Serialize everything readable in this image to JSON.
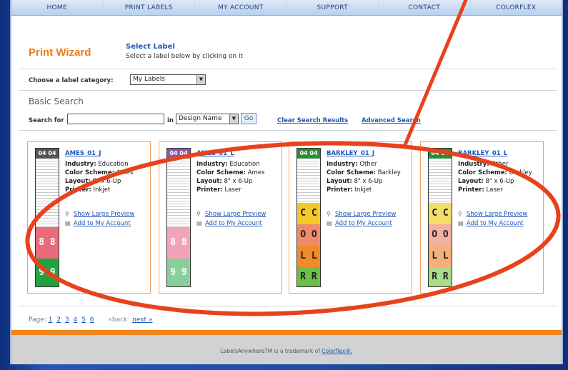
{
  "nav": {
    "items": [
      "HOME",
      "PRINT LABELS",
      "MY ACCOUNT",
      "SUPPORT",
      "CONTACT",
      "COLORFLEX"
    ]
  },
  "wizard": {
    "title": "Print Wizard",
    "step_title": "Select Label",
    "step_desc": "Select a label below by clicking on it"
  },
  "category": {
    "label": "Choose a label category:",
    "selected": "My Labels"
  },
  "search": {
    "heading": "Basic Search",
    "label": "Search for",
    "value": "",
    "in_label": "in",
    "field_selected": "Design Name",
    "go_label": "Go",
    "clear_label": "Clear Search Results",
    "advanced_label": "Advanced Search"
  },
  "cards": [
    {
      "title": "AMES_01_J",
      "industry": "Education",
      "color_scheme": "Ames",
      "layout": "8\" x 6-Up",
      "printer": "Inkjet",
      "thumb_top": "04 04",
      "preview_label": "Show Large Preview",
      "add_label": "Add to My Account"
    },
    {
      "title": "AMES_01_L",
      "industry": "Education",
      "color_scheme": "Ames",
      "layout": "8\" x 6-Up",
      "printer": "Laser",
      "thumb_top": "04 04",
      "preview_label": "Show Large Preview",
      "add_label": "Add to My Account"
    },
    {
      "title": "BARKLEY_01_J",
      "industry": "Other",
      "color_scheme": "Barkley",
      "layout": "8\" x 6-Up",
      "printer": "Inkjet",
      "thumb_top": "04 04",
      "preview_label": "Show Large Preview",
      "add_label": "Add to My Account"
    },
    {
      "title": "BARKLEY_01_L",
      "industry": "Other",
      "color_scheme": "Barkley",
      "layout": "8\" x 6-Up",
      "printer": "Laser",
      "thumb_top": "04 04",
      "preview_label": "Show Large Preview",
      "add_label": "Add to My Account"
    }
  ],
  "labels": {
    "industry": "Industry:",
    "color_scheme": "Color Scheme:",
    "layout": "Layout:",
    "printer": "Printer:"
  },
  "thumb_text": {
    "ames_a": "8 8",
    "ames_b": "9 9",
    "barkley_c": "C C",
    "barkley_o": "O O",
    "barkley_l": "L L",
    "barkley_r": "R R"
  },
  "pager": {
    "label": "Page:",
    "pages": [
      "1",
      "2",
      "3",
      "4",
      "5",
      "6"
    ],
    "back": "«back",
    "next": "next »"
  },
  "footer": {
    "text": "LabelsAnywhereTM is a trademark of",
    "link": "Colorflex®."
  },
  "colors": {
    "accent_orange": "#f07a13",
    "link_blue": "#1f56b8",
    "annotation_red": "#e8421c"
  }
}
